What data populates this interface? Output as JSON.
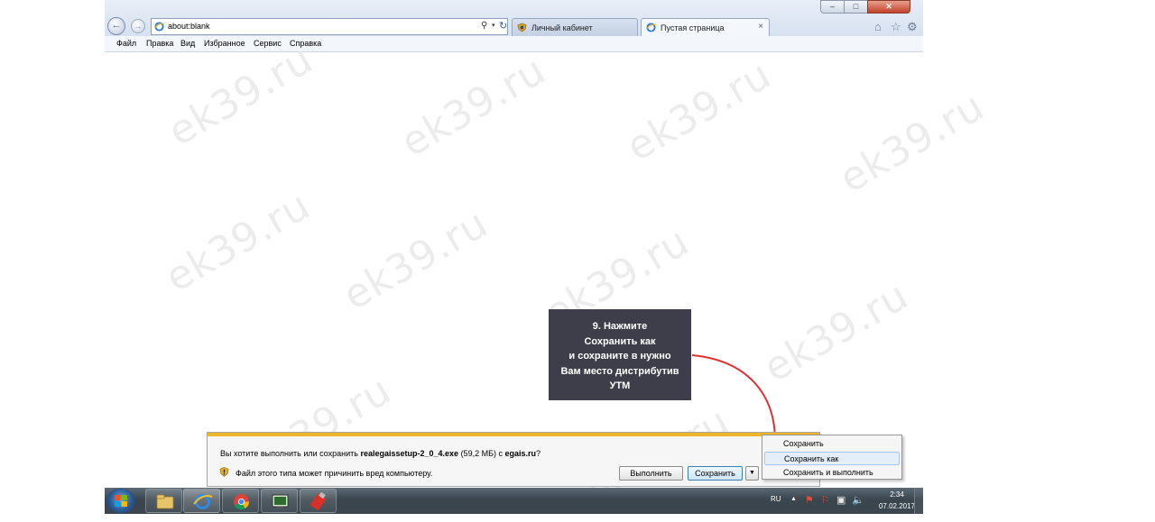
{
  "browser": {
    "address": "about:blank",
    "tabs": [
      {
        "label": "Личный кабинет"
      },
      {
        "label": "Пустая страница",
        "close": "×"
      }
    ],
    "window_controls": {
      "minimize": "–",
      "maximize": "□",
      "close": "✕"
    },
    "menu": [
      "Файл",
      "Правка",
      "Вид",
      "Избранное",
      "Сервис",
      "Справка"
    ],
    "icons": [
      "back-icon",
      "forward-icon",
      "search-icon",
      "refresh-icon",
      "home-icon",
      "star-icon",
      "gear-icon"
    ]
  },
  "watermark": "ek39.ru",
  "callout": {
    "text": "9. Нажмите\nСохранить  как\nи сохраните  в нужно\nВам место дистрибутив\nУТМ"
  },
  "notification": {
    "question_prefix": "Вы хотите выполнить или сохранить ",
    "filename": "realegaissetup-2_0_4.exe",
    "question_mid": " (59,2 МБ) с ",
    "source": "egais.ru",
    "question_suffix": "?",
    "warning": "Файл этого типа может причинить вред компьютеру.",
    "run_label": "Выполнить",
    "save_label": "Сохранить",
    "accent_color": "#f0b62a"
  },
  "save_menu": [
    {
      "label": "Сохранить"
    },
    {
      "label": "Сохранить как"
    },
    {
      "label": "Сохранить и выполнить"
    }
  ],
  "taskbar": {
    "apps": [
      "explorer-icon",
      "internet-explorer-icon",
      "chrome-icon",
      "monitor-icon",
      "utm-key-icon"
    ],
    "language": "RU",
    "time": "2:34",
    "date": "07.02.2017"
  },
  "colors": {
    "callout_bg": "#3e3e4a",
    "arrow": "#e03030"
  }
}
